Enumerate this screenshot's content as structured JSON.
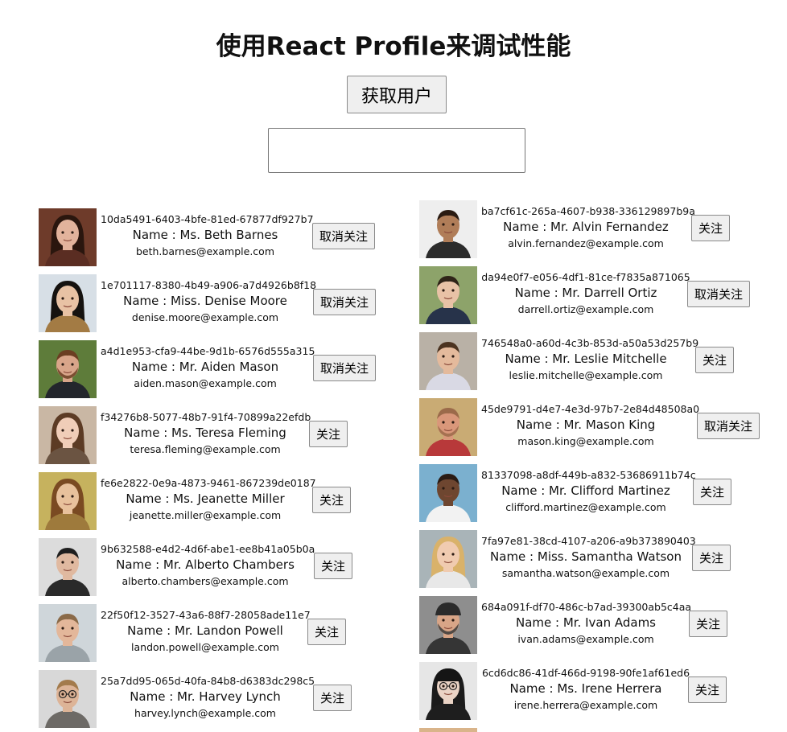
{
  "header": {
    "title": "使用React Profile来调试性能",
    "fetch_label": "获取用户"
  },
  "search": {
    "value": "",
    "placeholder": ""
  },
  "left_users": [
    {
      "id": "10da5491-6403-4bfe-81ed-67877df927b7",
      "name": "Name : Ms. Beth Barnes",
      "email": "beth.barnes@example.com",
      "action": "取消关注",
      "avatar": "woman-dark-hair"
    },
    {
      "id": "1e701117-8380-4b49-a906-a7d4926b8f18",
      "name": "Name : Miss. Denise Moore",
      "email": "denise.moore@example.com",
      "action": "取消关注",
      "avatar": "woman-long-hair"
    },
    {
      "id": "a4d1e953-cfa9-44be-9d1b-6576d555a315",
      "name": "Name : Mr. Aiden Mason",
      "email": "aiden.mason@example.com",
      "action": "取消关注",
      "avatar": "man-suit"
    },
    {
      "id": "f34276b8-5077-48b7-91f4-70899a22efdb",
      "name": "Name : Ms. Teresa Fleming",
      "email": "teresa.fleming@example.com",
      "action": "关注",
      "avatar": "woman-brown-hair"
    },
    {
      "id": "fe6e2822-0e9a-4873-9461-867239de0187",
      "name": "Name : Ms. Jeanette Miller",
      "email": "jeanette.miller@example.com",
      "action": "关注",
      "avatar": "woman-blonde"
    },
    {
      "id": "9b632588-e4d2-4d6f-abe1-ee8b41a05b0a",
      "name": "Name : Mr. Alberto Chambers",
      "email": "alberto.chambers@example.com",
      "action": "关注",
      "avatar": "man-dark-hair"
    },
    {
      "id": "22f50f12-3527-43a6-88f7-28058ade11e7",
      "name": "Name : Mr. Landon Powell",
      "email": "landon.powell@example.com",
      "action": "关注",
      "avatar": "man-outdoor"
    },
    {
      "id": "25a7dd95-065d-40fa-84b8-d6383dc298c5",
      "name": "Name : Mr. Harvey Lynch",
      "email": "harvey.lynch@example.com",
      "action": "关注",
      "avatar": "man-glasses"
    }
  ],
  "right_users": [
    {
      "id": "ba7cf61c-265a-4607-b938-336129897b9a",
      "name": "Name : Mr. Alvin Fernandez",
      "email": "alvin.fernandez@example.com",
      "action": "关注",
      "avatar": "man-bald"
    },
    {
      "id": "da94e0f7-e056-4df1-81ce-f7835a871065",
      "name": "Name : Mr. Darrell Ortiz",
      "email": "darrell.ortiz@example.com",
      "action": "取消关注",
      "avatar": "man-short-hair"
    },
    {
      "id": "746548a0-a60d-4c3b-853d-a50a53d257b9",
      "name": "Name : Mr. Leslie Mitchelle",
      "email": "leslie.mitchelle@example.com",
      "action": "关注",
      "avatar": "man-shirt"
    },
    {
      "id": "45de9791-d4e7-4e3d-97b7-2e84d48508a0",
      "name": "Name : Mr. Mason King",
      "email": "mason.king@example.com",
      "action": "取消关注",
      "avatar": "man-beard"
    },
    {
      "id": "81337098-a8df-449b-a832-53686911b74c",
      "name": "Name : Mr. Clifford Martinez",
      "email": "clifford.martinez@example.com",
      "action": "关注",
      "avatar": "man-smiling"
    },
    {
      "id": "7fa97e81-38cd-4107-a206-a9b373890403",
      "name": "Name : Miss. Samantha Watson",
      "email": "samantha.watson@example.com",
      "action": "关注",
      "avatar": "woman-blonde-smile"
    },
    {
      "id": "684a091f-df70-486c-b7ad-39300ab5c4aa",
      "name": "Name : Mr. Ivan Adams",
      "email": "ivan.adams@example.com",
      "action": "关注",
      "avatar": "man-cap"
    },
    {
      "id": "6cd6dc86-41df-466d-9198-90fe1af61ed6",
      "name": "Name : Ms. Irene Herrera",
      "email": "irene.herrera@example.com",
      "action": "关注",
      "avatar": "woman-glasses"
    }
  ]
}
